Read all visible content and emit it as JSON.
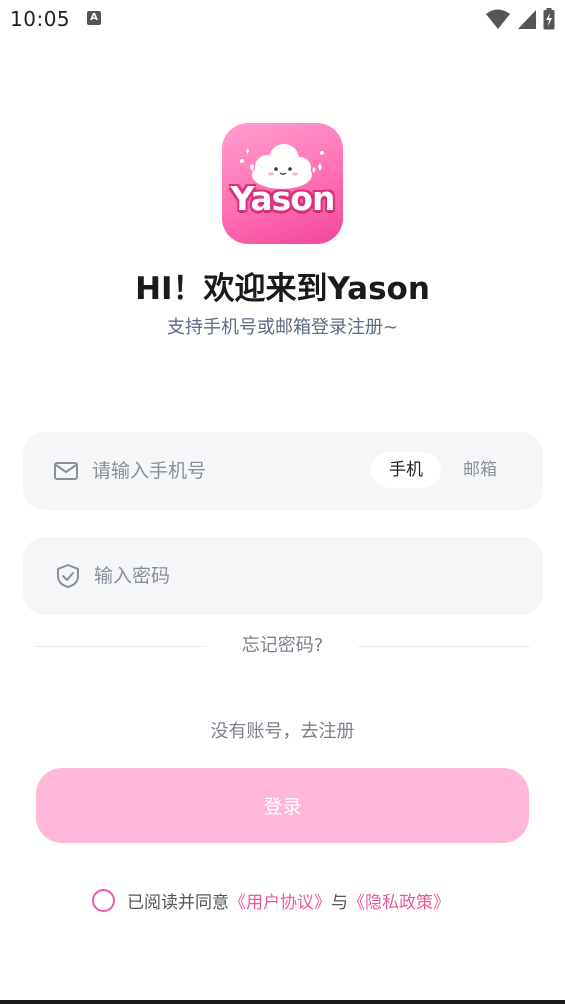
{
  "status_bar": {
    "time": "10:05",
    "notification_glyph": "A",
    "icons": [
      "wifi-icon",
      "signal-icon",
      "battery-icon"
    ]
  },
  "logo": {
    "text": "Yason"
  },
  "header": {
    "title": "HI！欢迎来到Yason",
    "subtitle": "支持手机号或邮箱登录注册~"
  },
  "phone_field": {
    "placeholder": "请输入手机号",
    "value": "",
    "icon": "mail-icon",
    "toggle": {
      "phone_label": "手机",
      "email_label": "邮箱",
      "selected": "手机"
    }
  },
  "password_field": {
    "placeholder": "输入密码",
    "value": "",
    "icon": "shield-check-icon"
  },
  "links": {
    "forgot": "忘记密码?",
    "register": "没有账号，去注册"
  },
  "login_button": {
    "label": "登录"
  },
  "agreement": {
    "prefix": "已阅读并同意",
    "user_agreement": "《用户协议》",
    "connector": "与",
    "privacy_policy": "《隐私政策》"
  },
  "colors": {
    "accent": "#ea5aa0",
    "button": "#ffb4d8",
    "field_bg": "#f5f6f8"
  }
}
